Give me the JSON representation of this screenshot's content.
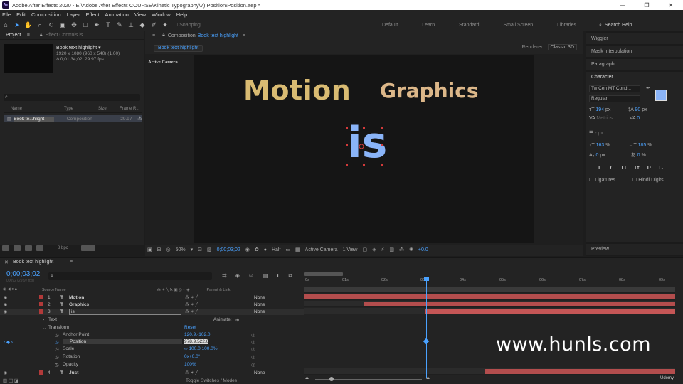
{
  "window": {
    "title": "Adobe After Effects 2020 - E:\\Adobe After Effects COURSE\\Kinetic Typography\\7) Position\\Position.aep *",
    "app_icon": "Ae"
  },
  "menu": [
    "File",
    "Edit",
    "Composition",
    "Layer",
    "Effect",
    "Animation",
    "View",
    "Window",
    "Help"
  ],
  "toolbar": {
    "snapping_label": "Snapping",
    "workspaces": [
      "Default",
      "Learn",
      "Standard",
      "Small Screen",
      "Libraries"
    ],
    "search_placeholder": "Search Help"
  },
  "project": {
    "tab_project": "Project",
    "tab_effect_controls": "Effect Controls is",
    "item_name": "Book text highlight ▾",
    "item_dims": "1920 x 1080  (960 x 540) (1.00)",
    "item_duration": "Δ 0;01;34;02, 29.97 fps",
    "search_icon": "⌕",
    "col_name": "Name",
    "col_type": "Type",
    "col_size": "Size",
    "col_frame": "Frame R...",
    "row_name": "Book te...hlight",
    "row_type": "Composition",
    "row_fps": "29.97",
    "bpc": "8 bpc"
  },
  "composition": {
    "tab_label": "Composition",
    "tab_name": "Book text highlight",
    "crumb": "Book text highlight",
    "renderer_label": "Renderer:",
    "renderer_value": "Classic 3D",
    "active_camera": "Active Camera",
    "words": [
      {
        "text": "Motion",
        "color": "#d9bb72"
      },
      {
        "text": "Graphics",
        "color": "#dcb789"
      },
      {
        "text": "is",
        "color": "#8ab4f8"
      }
    ],
    "bottom": {
      "zoom": "50%",
      "timecode": "0;00;03;02",
      "resolution": "Half",
      "view": "Active Camera",
      "views": "1 View",
      "exposure": "+0.0"
    }
  },
  "right_panel": {
    "wiggler": "Wiggler",
    "mask_interp": "Mask Interpolation",
    "paragraph": "Paragraph",
    "character": "Character",
    "font": "Tw Cen MT Cond...",
    "style": "Regular",
    "size": "194",
    "size_unit": "px",
    "leading": "90",
    "leading_unit": "px",
    "kerning": "Metrics",
    "tracking": "0",
    "stroke_unit": "- px",
    "vert_scale": "163",
    "horiz_scale": "185",
    "baseline": "0",
    "baseline_unit": "px",
    "tsume": "0",
    "tsume_unit": "%",
    "text_styles": [
      "T",
      "T",
      "TT",
      "Tт",
      "T¹",
      "T₁"
    ],
    "ligatures": "Ligatures",
    "hindi": "Hindi Digits",
    "preview": "Preview",
    "fill_color": "#8ab4f8"
  },
  "timeline": {
    "tab": "Book text highlight",
    "current_time": "0;00;03;02",
    "fps_note": "00092 (29.97 fps)",
    "col_source": "Source Name",
    "col_parent": "Parent & Link",
    "layers": [
      {
        "num": "1",
        "name": "Motion",
        "parent": "None"
      },
      {
        "num": "2",
        "name": "Graphics",
        "parent": "None"
      },
      {
        "num": "3",
        "name": "is",
        "parent": "None"
      }
    ],
    "layer4": {
      "num": "4",
      "name": "Just",
      "parent": "None"
    },
    "text_group": "Text",
    "animate": "Animate:",
    "transform": "Transform",
    "reset": "Reset",
    "props": [
      {
        "name": "Anchor Point",
        "value": "120.9,-102.0"
      },
      {
        "name": "Position",
        "value": "978.9,522.0"
      },
      {
        "name": "Scale",
        "value": "∞ 100.0,100.0%"
      },
      {
        "name": "Rotation",
        "value": "0x+0.0°"
      },
      {
        "name": "Opacity",
        "value": "100%"
      }
    ],
    "ruler": [
      "0s",
      "01s",
      "02s",
      "03s",
      "04s",
      "05s",
      "06s",
      "07s",
      "08s",
      "09s"
    ],
    "bottom_label": "Toggle Switches / Modes",
    "udemy": "Udemy"
  },
  "watermark": "www.hunls.com"
}
